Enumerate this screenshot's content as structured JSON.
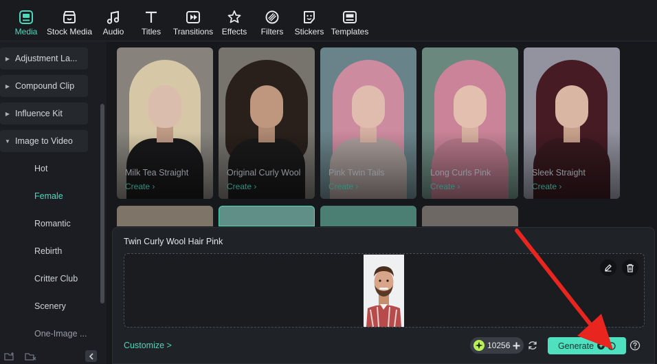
{
  "toolbar": {
    "tabs": [
      {
        "label": "Media",
        "icon": "media-icon",
        "active": true
      },
      {
        "label": "Stock Media",
        "icon": "stock-media-icon",
        "active": false
      },
      {
        "label": "Audio",
        "icon": "audio-icon",
        "active": false
      },
      {
        "label": "Titles",
        "icon": "titles-icon",
        "active": false
      },
      {
        "label": "Transitions",
        "icon": "transitions-icon",
        "active": false
      },
      {
        "label": "Effects",
        "icon": "effects-icon",
        "active": false
      },
      {
        "label": "Filters",
        "icon": "filters-icon",
        "active": false
      },
      {
        "label": "Stickers",
        "icon": "stickers-icon",
        "active": false
      },
      {
        "label": "Templates",
        "icon": "templates-icon",
        "active": false
      }
    ]
  },
  "sidebar": {
    "items": [
      {
        "label": "Adjustment La...",
        "expanded": false
      },
      {
        "label": "Compound Clip",
        "expanded": false
      },
      {
        "label": "Influence Kit",
        "expanded": false
      },
      {
        "label": "Image to Video",
        "expanded": true
      }
    ],
    "subitems": [
      {
        "label": "Hot",
        "active": false
      },
      {
        "label": "Female",
        "active": true
      },
      {
        "label": "Romantic",
        "active": false
      },
      {
        "label": "Rebirth",
        "active": false
      },
      {
        "label": "Critter Club",
        "active": false
      },
      {
        "label": "Scenery",
        "active": false
      },
      {
        "label": "One-Image ...",
        "active": false
      }
    ]
  },
  "templates": [
    {
      "title": "Milk Tea Straight",
      "create": "Create"
    },
    {
      "title": "Original Curly Wool",
      "create": "Create"
    },
    {
      "title": "Pink Twin Tails",
      "create": "Create"
    },
    {
      "title": "Long Curls Pink",
      "create": "Create"
    },
    {
      "title": "Sleek Straight",
      "create": "Create"
    }
  ],
  "panel": {
    "title": "Twin Curly Wool Hair Pink",
    "customize": "Customize >",
    "credits": "10256",
    "generate": "Generate",
    "generate_cost_icon": "credit-coin-icon"
  },
  "colors": {
    "accent": "#4fd8bc",
    "generate_button": "#4fe0c0",
    "annotation_arrow": "#e8251f"
  }
}
